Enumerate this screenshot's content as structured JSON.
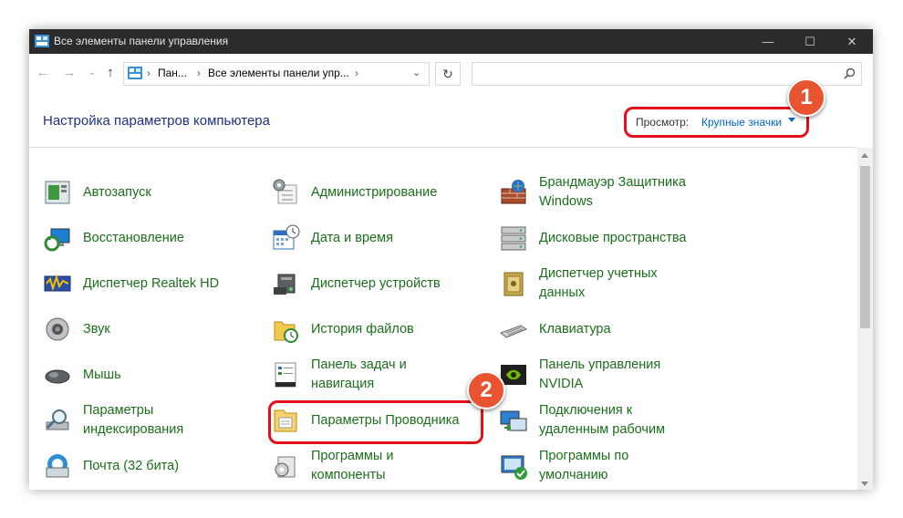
{
  "window": {
    "title": "Все элементы панели управления"
  },
  "address": {
    "segment1": "Пан...",
    "segment2": "Все элементы панели упр...",
    "search_placeholder": ""
  },
  "header": {
    "title": "Настройка параметров компьютера",
    "view_label": "Просмотр:",
    "view_value": "Крупные значки"
  },
  "items": {
    "autoplay": "Автозапуск",
    "admin": "Администрирование",
    "firewall_1": "Брандмауэр Защитника",
    "firewall_2": "Windows",
    "recovery": "Восстановление",
    "datetime": "Дата и время",
    "storage": "Дисковые пространства",
    "realtek": "Диспетчер Realtek HD",
    "devmgr": "Диспетчер устройств",
    "credmgr_1": "Диспетчер учетных",
    "credmgr_2": "данных",
    "sound": "Звук",
    "filehistory": "История файлов",
    "keyboard": "Клавиатура",
    "mouse": "Мышь",
    "taskbar_1": "Панель задач и",
    "taskbar_2": "навигация",
    "nvidia_1": "Панель управления",
    "nvidia_2": "NVIDIA",
    "indexing_1": "Параметры",
    "indexing_2": "индексирования",
    "explorer": "Параметры Проводника",
    "rdp_1": "Подключения к",
    "rdp_2": "удаленным рабочим",
    "mail": "Почта (32 бита)",
    "programs_1": "Программы и",
    "programs_2": "компоненты",
    "defaults_1": "Программы по",
    "defaults_2": "умолчанию"
  },
  "callouts": {
    "one": "1",
    "two": "2"
  },
  "colors": {
    "accent_red": "#e3101a",
    "badge": "#e8542f",
    "link_green": "#1b6e1b",
    "title_blue": "#1e3287"
  }
}
